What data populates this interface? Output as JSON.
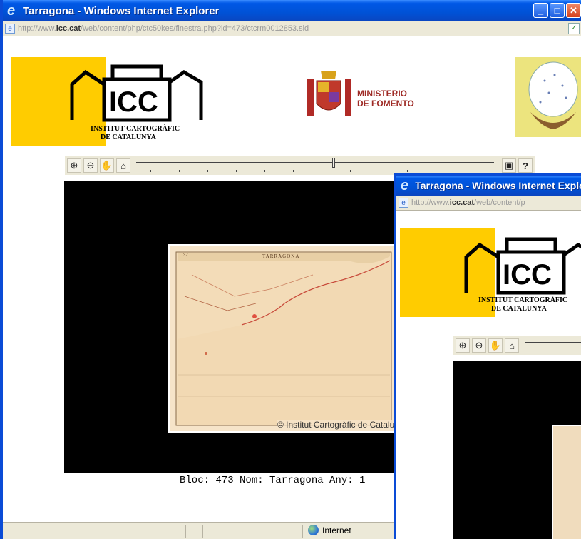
{
  "windows": [
    {
      "title": "Tarragona - Windows Internet Explorer",
      "url_prefix": "http://www.",
      "url_domain": "icc.cat",
      "url_path": "/web/content/php/ctc50kes/finestra.php?id=473/ctcrm0012853.sid",
      "logo": {
        "letters": "ICC",
        "line1": "INSTITUT CARTOGRÀFIC",
        "line2": "DE CATALUNYA"
      },
      "ministry": {
        "line1": "MINISTERIO",
        "line2": "DE FOMENTO"
      },
      "map": {
        "sheet_title": "TARRAGONA",
        "sheet_number": "37",
        "copyright": "© Institut Cartogràfic de Catalunya"
      },
      "caption": "Bloc: 473 Nom: Tarragona Any: 1",
      "status_zone": "Internet",
      "colors": {
        "titlebar": "#0058e6",
        "yellow": "#ffcc00",
        "map_bg": "#000000",
        "paper": "#f6e4c9"
      }
    },
    {
      "title": "Tarragona - Windows Internet Explorer",
      "url_prefix": "http://www.",
      "url_domain": "icc.cat",
      "url_path": "/web/content/p",
      "logo": {
        "letters": "ICC",
        "line1": "INSTITUT CARTOGRÀFIC",
        "line2": "DE CATALUNYA"
      }
    }
  ],
  "icons": {
    "zoom_in": "zoom-in-icon",
    "zoom_out": "zoom-out-icon",
    "pan": "hand-icon",
    "home": "home-icon",
    "print": "print-icon",
    "help": "help-icon",
    "internet_zone": "globe-icon"
  },
  "toolbar": {
    "zoom_in_glyph": "⊕",
    "zoom_out_glyph": "⊖",
    "pan_glyph": "✋",
    "home_glyph": "⌂",
    "print_glyph": "▣",
    "help_glyph": "?"
  },
  "window_buttons": {
    "minimize": "_",
    "maximize": "□",
    "close": "✕"
  }
}
